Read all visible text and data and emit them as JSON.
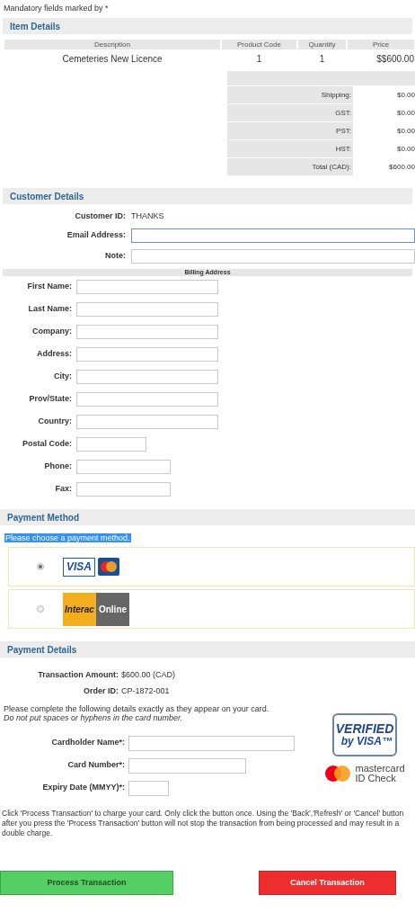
{
  "mandatory_note": "Mandatory fields marked by *",
  "item_details": {
    "title": "Item Details",
    "columns": [
      "Description",
      "Product Code",
      "Quantity",
      "Price"
    ],
    "rows": [
      [
        "Cemeteries New Licence",
        "1",
        "1",
        "$$600.00"
      ]
    ],
    "totals": [
      {
        "label": "Shipping:",
        "value": "$0.00"
      },
      {
        "label": "GST:",
        "value": "$0.00"
      },
      {
        "label": "PST:",
        "value": "$0.00"
      },
      {
        "label": "HST:",
        "value": "$0.00"
      },
      {
        "label": "Total (CAD):",
        "value": "$600.00"
      }
    ]
  },
  "customer_details": {
    "title": "Customer Details",
    "customer_id": {
      "label": "Customer ID:",
      "value": "THANKS"
    },
    "fields": [
      {
        "label": "Email Address:",
        "focused": true
      },
      {
        "label": "Note:",
        "focused": false
      }
    ]
  },
  "billing_address": {
    "title": "Billing Address",
    "fields": [
      {
        "label": "First Name:",
        "kind": "long"
      },
      {
        "label": "Last Name:",
        "kind": "long"
      },
      {
        "label": "Company:",
        "kind": "long"
      },
      {
        "label": "Address:",
        "kind": "long"
      },
      {
        "label": "City:",
        "kind": "long"
      },
      {
        "label": "Prov/State:",
        "kind": "long"
      },
      {
        "label": "Country:",
        "kind": "long"
      },
      {
        "label": "Postal Code:",
        "kind": "short"
      },
      {
        "label": "Phone:",
        "kind": "medium"
      },
      {
        "label": "Fax:",
        "kind": "medium"
      }
    ]
  },
  "payment_method": {
    "title": "Payment Method",
    "prompt": "Please choose a payment method.",
    "options": [
      {
        "kind": "card",
        "selected": true,
        "logo": [
          "VISA"
        ]
      },
      {
        "kind": "interac",
        "selected": false,
        "logo": [
          "Interac",
          "Online"
        ]
      }
    ]
  },
  "payment_details": {
    "title": "Payment Details",
    "summary": [
      {
        "label": "Transaction Amount:",
        "value": "$600.00 (CAD)"
      },
      {
        "label": "Order ID:",
        "value": "CP-1872-001"
      }
    ],
    "instructions": "Please complete the following details exactly as they appear on your card.",
    "hint": "Do not put spaces or hyphens in the card number.",
    "card_fields": [
      {
        "label": "Cardholder Name*:",
        "kind": "long"
      },
      {
        "label": "Card Number*:",
        "kind": "medium"
      },
      {
        "label": "Expiry Date (MMYY)*:",
        "kind": "short"
      }
    ],
    "verified_badge": [
      "VERIFIED",
      "by VISA™"
    ],
    "id_check_badge": [
      "mastercard",
      "ID Check"
    ]
  },
  "notice": "Click 'Process Transaction' to charge your card. Only click the button once. Using the 'Back','Refresh' or 'Cancel' button after you press the 'Process Transaction' button will not stop the transaction from being processed and may result in a double charge.",
  "buttons": [
    {
      "label": "Process Transaction",
      "kind": "process"
    },
    {
      "label": "Cancel Transaction",
      "kind": "cancel"
    }
  ]
}
